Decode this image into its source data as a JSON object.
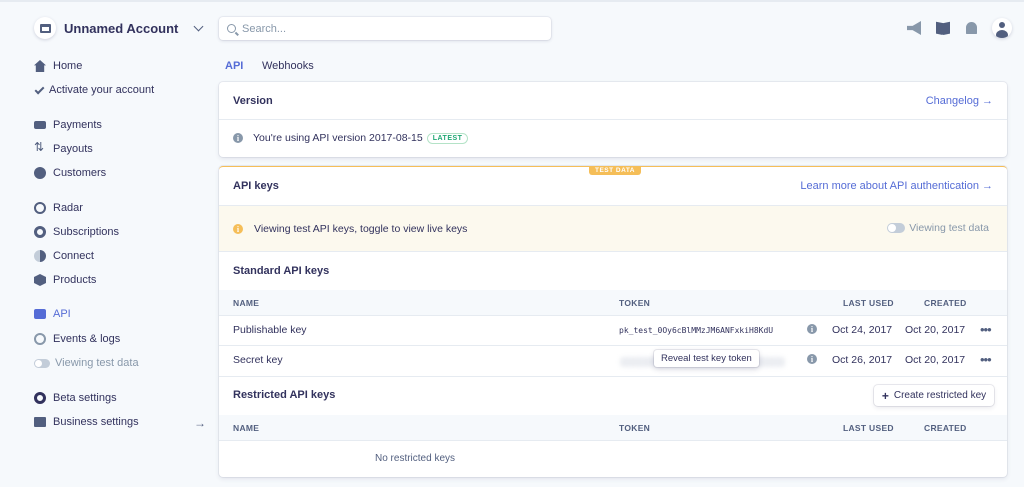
{
  "account": {
    "name": "Unnamed Account"
  },
  "search": {
    "placeholder": "Search..."
  },
  "sidebar": {
    "items": [
      {
        "label": "Home",
        "icon": "home-icon"
      },
      {
        "label": "Activate your account",
        "icon": "check-icon"
      },
      {
        "label": "Payments",
        "icon": "payments-icon"
      },
      {
        "label": "Payouts",
        "icon": "payouts-icon"
      },
      {
        "label": "Customers",
        "icon": "customers-icon"
      },
      {
        "label": "Radar",
        "icon": "radar-icon"
      },
      {
        "label": "Subscriptions",
        "icon": "subscriptions-icon"
      },
      {
        "label": "Connect",
        "icon": "connect-icon"
      },
      {
        "label": "Products",
        "icon": "products-icon"
      },
      {
        "label": "API",
        "icon": "api-icon",
        "active": true
      },
      {
        "label": "Events & logs",
        "icon": "events-icon"
      },
      {
        "label": "Viewing test data",
        "icon": "toggle-icon"
      },
      {
        "label": "Beta settings",
        "icon": "gear-icon"
      },
      {
        "label": "Business settings",
        "icon": "business-icon"
      }
    ]
  },
  "tabs": [
    {
      "label": "API"
    },
    {
      "label": "Webhooks"
    }
  ],
  "version_card": {
    "title": "Version",
    "link": "Changelog →",
    "message": "You're using API version 2017-08-15",
    "badge": "LATEST"
  },
  "api_keys_card": {
    "badge": "TEST DATA",
    "title": "API keys",
    "link": "Learn more about API authentication →",
    "notice": "Viewing test API keys, toggle to view live keys",
    "toggle_label": "Viewing test data",
    "standard": {
      "title": "Standard API keys",
      "columns": {
        "name": "NAME",
        "token": "TOKEN",
        "last_used": "LAST USED",
        "created": "CREATED"
      },
      "rows": [
        {
          "name": "Publishable key",
          "token": "pk_test_0Oy6cBlMMzJM6ANFxkiH8KdU",
          "last_used": "Oct 24, 2017",
          "created": "Oct 20, 2017",
          "more": "•••"
        },
        {
          "name": "Secret key",
          "token": "",
          "last_used": "Oct 26, 2017",
          "created": "Oct 20, 2017",
          "more": "•••"
        }
      ],
      "reveal_tooltip": "Reveal test key token"
    },
    "restricted": {
      "title": "Restricted API keys",
      "create_button": "Create restricted key",
      "columns": {
        "name": "NAME",
        "token": "TOKEN",
        "last_used": "LAST USED",
        "created": "CREATED"
      },
      "empty": "No restricted keys"
    }
  },
  "colors": {
    "accent": "#556cd6",
    "warning": "#f5be58",
    "success": "#1ea672",
    "text": "#32325d"
  }
}
